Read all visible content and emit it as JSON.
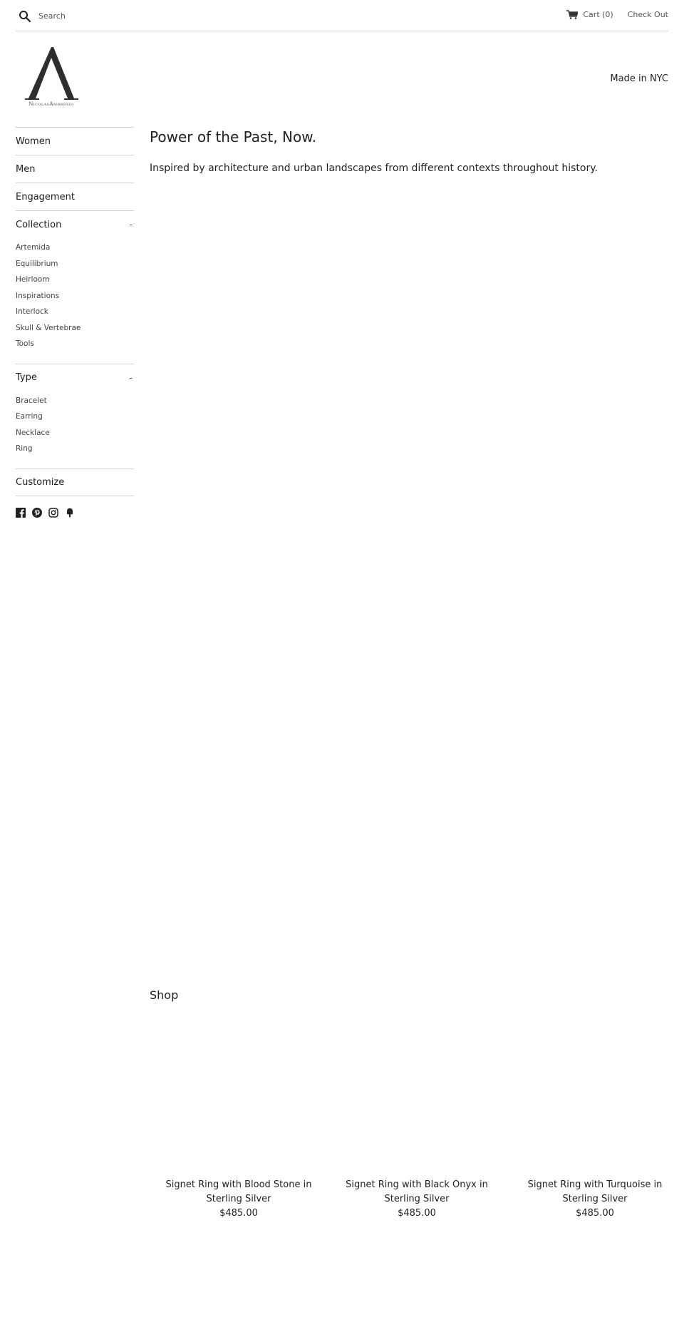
{
  "header": {
    "search_placeholder": "Search",
    "cart_label": "Cart (0)",
    "checkout_label": "Check Out"
  },
  "brand": {
    "logo_text": "NicolasAmbrosio",
    "tagline": "Made in NYC"
  },
  "sidebar": {
    "nav": [
      {
        "label": "Women"
      },
      {
        "label": "Men"
      },
      {
        "label": "Engagement"
      }
    ],
    "collection": {
      "label": "Collection",
      "toggle": "-",
      "items": [
        "Artemida",
        "Equilibrium",
        "Heirloom",
        "Inspirations",
        "Interlock",
        "Skull & Vertebrae",
        "Tools"
      ]
    },
    "type": {
      "label": "Type",
      "toggle": "-",
      "items": [
        "Bracelet",
        "Earring",
        "Necklace",
        "Ring"
      ]
    },
    "customize_label": "Customize",
    "social": [
      "facebook-icon",
      "pinterest-icon",
      "instagram-icon",
      "fancy-icon"
    ]
  },
  "main": {
    "title": "Power of the Past, Now.",
    "description": "Inspired by architecture and urban landscapes from different contexts throughout history.",
    "shop_title": "Shop",
    "products": [
      {
        "name": "Signet Ring with Blood Stone in Sterling Silver",
        "price": "$485.00"
      },
      {
        "name": "Signet Ring with Black Onyx in Sterling Silver",
        "price": "$485.00"
      },
      {
        "name": "Signet Ring with Turquoise in Sterling Silver",
        "price": "$485.00"
      }
    ]
  },
  "colors": {
    "text": "#222222",
    "muted": "#555555",
    "border": "#cfcfcf"
  }
}
